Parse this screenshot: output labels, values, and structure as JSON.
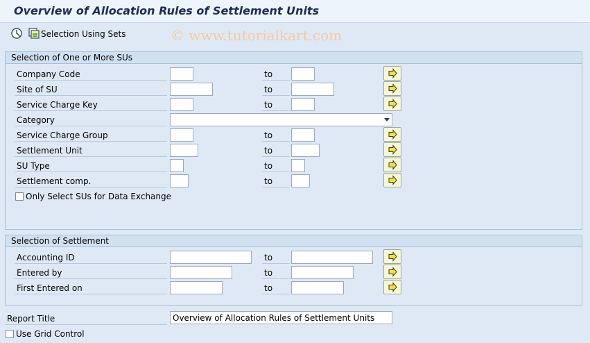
{
  "title": "Overview of Allocation Rules of Settlement Units",
  "toolbar": {
    "execute_icon": "execute-clock-icon",
    "sets_icon": "selection-sets-icon",
    "sets_label": "Selection Using Sets"
  },
  "watermark": "© www.tutorialkart.com",
  "group1": {
    "title": "Selection of One or More SUs",
    "rows": [
      {
        "label": "Company Code",
        "to": "to",
        "from_value": "",
        "to_value": ""
      },
      {
        "label": "Site of SU",
        "to": "to",
        "from_value": "",
        "to_value": ""
      },
      {
        "label": "Service Charge Key",
        "to": "to",
        "from_value": "",
        "to_value": ""
      },
      {
        "label": "Category",
        "value": ""
      },
      {
        "label": "Service Charge Group",
        "to": "to",
        "from_value": "",
        "to_value": ""
      },
      {
        "label": "Settlement Unit",
        "to": "to",
        "from_value": "",
        "to_value": ""
      },
      {
        "label": "SU Type",
        "to": "to",
        "from_value": "",
        "to_value": ""
      },
      {
        "label": "Settlement comp.",
        "to": "to",
        "from_value": "",
        "to_value": ""
      }
    ],
    "checkbox_label": "Only Select SUs for Data Exchange"
  },
  "group2": {
    "title": "Selection of Settlement",
    "rows": [
      {
        "label": "Accounting ID",
        "to": "to",
        "from_value": "",
        "to_value": ""
      },
      {
        "label": "Entered by",
        "to": "to",
        "from_value": "",
        "to_value": ""
      },
      {
        "label": "First Entered on",
        "to": "to",
        "from_value": "",
        "to_value": ""
      }
    ]
  },
  "report_title": {
    "label": "Report Title",
    "value": "Overview of Allocation Rules of Settlement Units"
  },
  "grid_control": {
    "label": "Use Grid Control"
  },
  "colors": {
    "accent_arrow": "#f3e23a",
    "background": "#dfe9f5"
  }
}
